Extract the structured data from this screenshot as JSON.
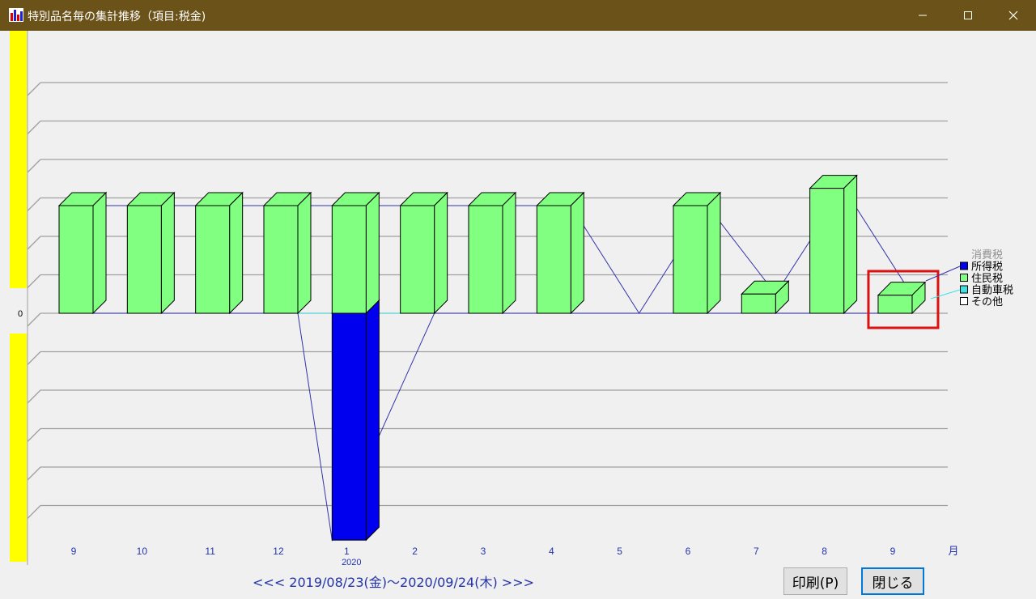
{
  "window": {
    "title": "特別品名毎の集計推移（項目:税金)",
    "controls": [
      "minimize",
      "maximize",
      "close"
    ]
  },
  "chart_data": {
    "type": "bar",
    "categories": [
      "9",
      "10",
      "11",
      "12",
      "1",
      "2",
      "3",
      "4",
      "5",
      "6",
      "7",
      "8",
      "9"
    ],
    "year_label": "2020",
    "x_unit_label": "月",
    "zero_label": "0",
    "series": [
      {
        "name": "消費税",
        "values": [
          0,
          0,
          0,
          0,
          0,
          0,
          0,
          0,
          0,
          0,
          0,
          0,
          0
        ]
      },
      {
        "name": "所得税",
        "values": [
          0,
          0,
          0,
          0,
          -5.9,
          0,
          0,
          0,
          0,
          0,
          0,
          0,
          0
        ]
      },
      {
        "name": "住民税",
        "values": [
          2.8,
          2.8,
          2.8,
          2.8,
          2.8,
          2.8,
          2.8,
          2.8,
          0,
          2.8,
          0.5,
          3.25,
          0.47
        ]
      },
      {
        "name": "自動車税",
        "values": [
          0,
          0,
          0,
          0,
          0,
          0,
          0,
          0,
          0,
          0,
          0,
          0,
          0
        ]
      },
      {
        "name": "その他",
        "values": [
          0,
          0,
          0,
          0,
          0,
          0,
          0,
          0,
          0,
          0,
          0,
          0,
          0
        ]
      }
    ],
    "colors": {
      "所得税": "#0000ee",
      "住民税": "#80ff80",
      "自動車税": "#40e0e0",
      "その他": "#ffffff",
      "消費税": "#a0a0a0"
    },
    "legend_position": "right",
    "highlight_category_index": 12,
    "highlight_color": "#dd1111"
  },
  "footer": {
    "date_range": "<<< 2019/08/23(金)～2020/09/24(木) >>>",
    "print_button": "印刷(P)",
    "close_button": "閉じる"
  }
}
